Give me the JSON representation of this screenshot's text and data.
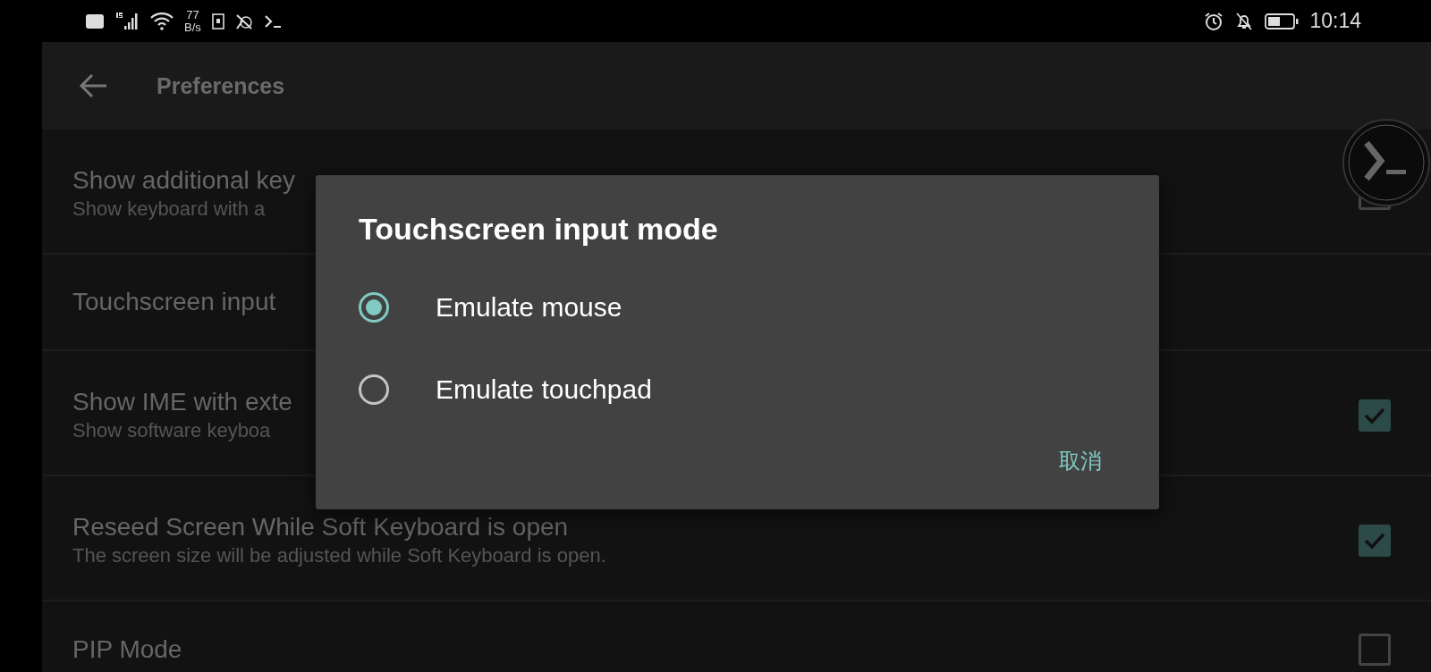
{
  "status_bar": {
    "network_speed_value": "77",
    "network_speed_unit": "B/s",
    "time": "10:14"
  },
  "app_bar": {
    "title": "Preferences"
  },
  "preferences": [
    {
      "kind": "checkbox",
      "title": "Show additional key",
      "summary": "Show keyboard with a",
      "checked": false
    },
    {
      "kind": "plain",
      "title": "Touchscreen input"
    },
    {
      "kind": "checkbox",
      "title": "Show IME with exte",
      "summary": "Show software keyboa",
      "checked": true
    },
    {
      "kind": "checkbox",
      "title": "Reseed Screen While Soft Keyboard is open",
      "summary": "The screen size will be adjusted while Soft Keyboard is open.",
      "checked": true
    },
    {
      "kind": "checkbox",
      "title": "PIP Mode",
      "checked": false
    }
  ],
  "dialog": {
    "title": "Touchscreen input mode",
    "options": [
      {
        "label": "Emulate mouse",
        "selected": true
      },
      {
        "label": "Emulate touchpad",
        "selected": false
      }
    ],
    "buttons": [
      "取消"
    ]
  }
}
